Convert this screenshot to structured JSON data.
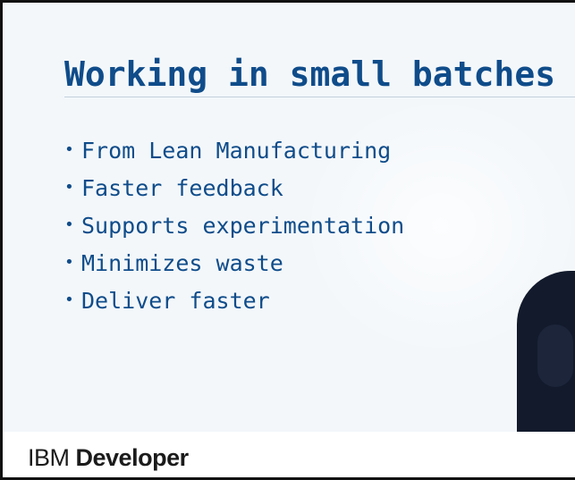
{
  "slide": {
    "title": "Working in small batches",
    "bullet_glyph": "•",
    "bullets": [
      "From Lean Manufacturing",
      "Faster feedback",
      "Supports experimentation",
      "Minimizes waste",
      "Deliver faster"
    ],
    "colors": {
      "text": "#0f4c8a",
      "background": "#f3f7fa"
    }
  },
  "footer": {
    "brand_prefix": "IBM",
    "brand_name": "Developer"
  }
}
